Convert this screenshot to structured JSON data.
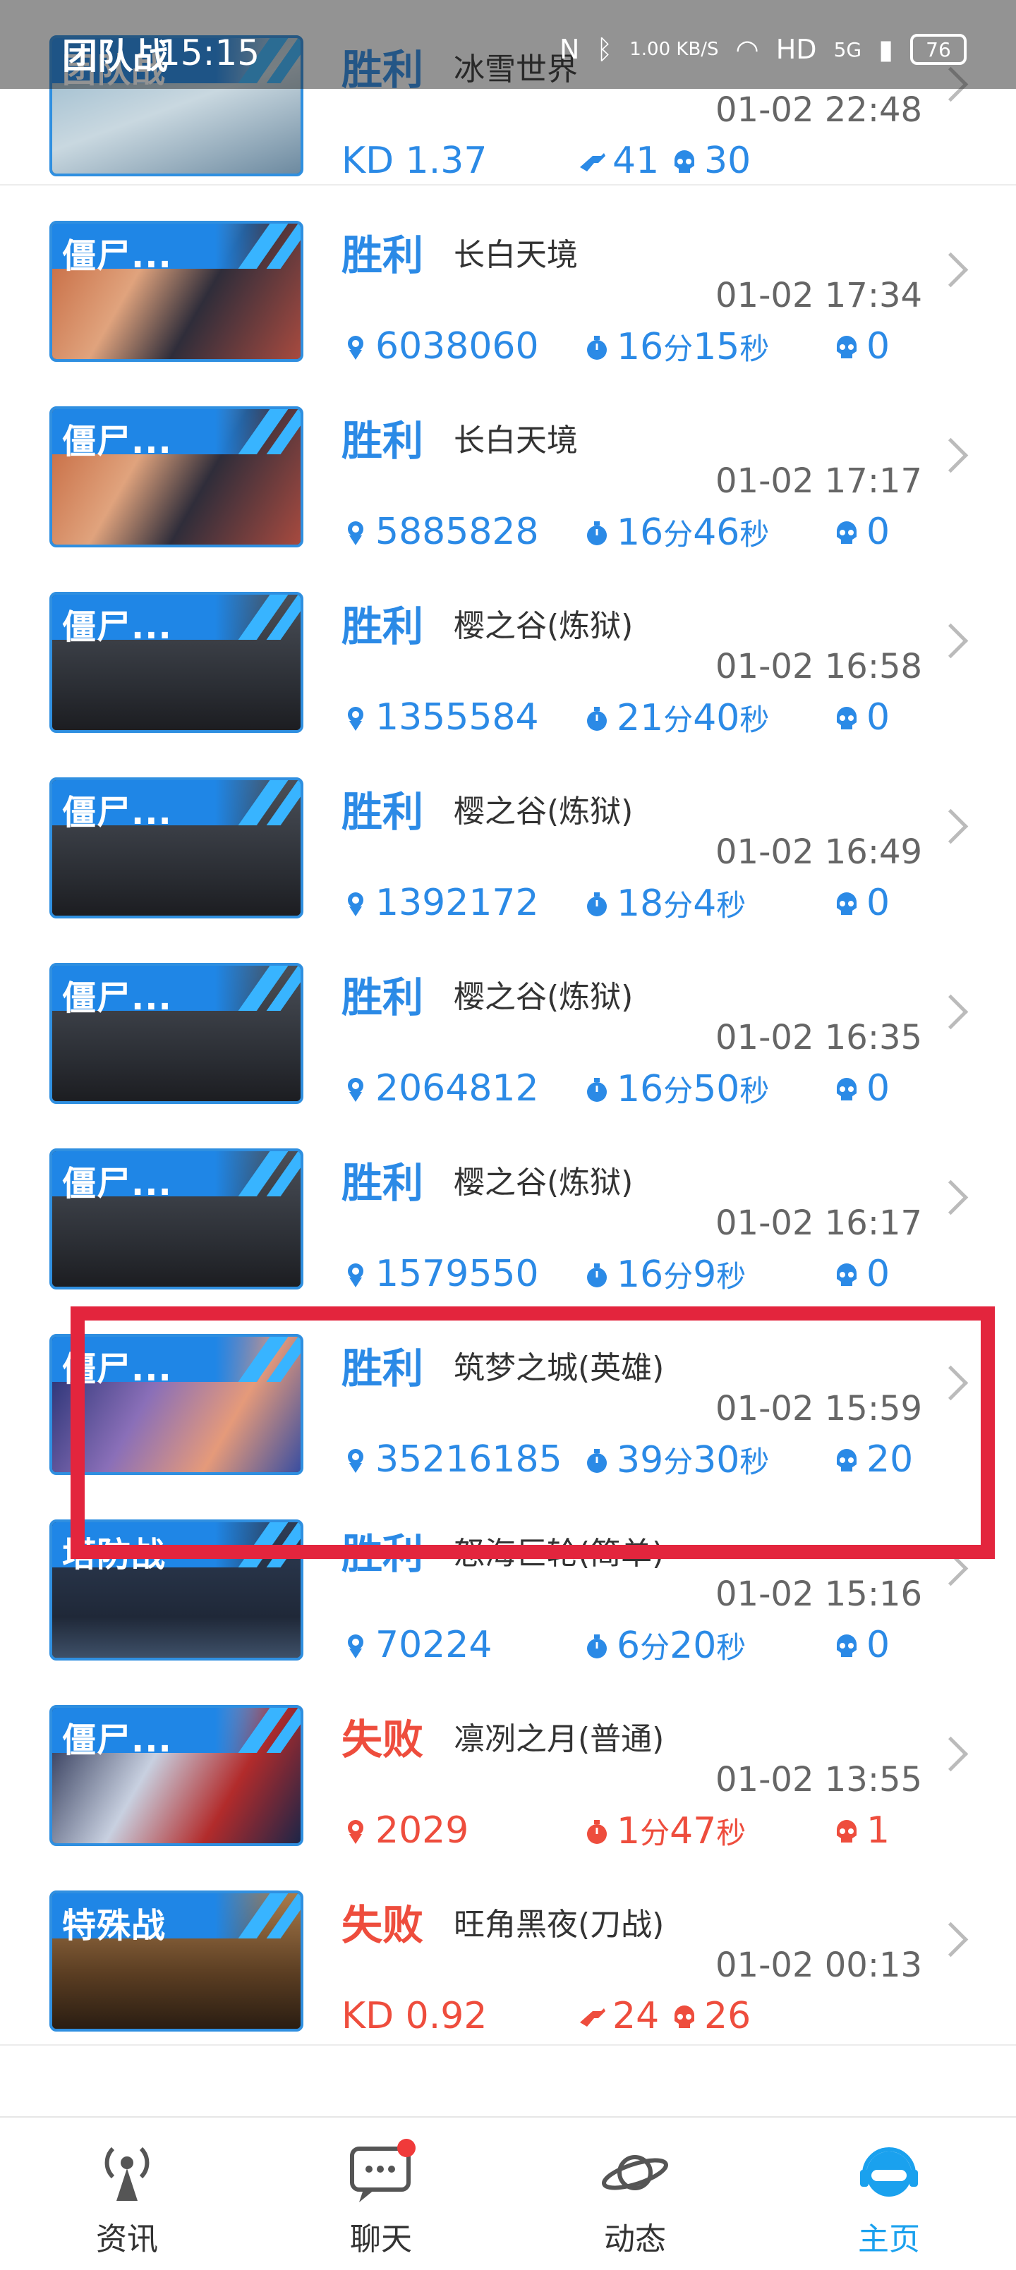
{
  "status_bar": {
    "overlay_badge": "团队战",
    "time": "15:15",
    "net_speed": "1.00 KB/S",
    "network": "5G",
    "battery": "76"
  },
  "records": [
    {
      "mode": "团队战",
      "result": "胜利",
      "map": "冰雪世界",
      "time": "01-02 22:48",
      "stats": {
        "kd": "KD 1.37",
        "kills": "41",
        "deaths": "30"
      }
    },
    {
      "mode": "僵尸...",
      "result": "胜利",
      "map": "长白天境",
      "time": "01-02 17:34",
      "stats": {
        "score": "6038060",
        "duration": {
          "min": "16",
          "sec": "15"
        },
        "deaths": "0"
      }
    },
    {
      "mode": "僵尸...",
      "result": "胜利",
      "map": "长白天境",
      "time": "01-02 17:17",
      "stats": {
        "score": "5885828",
        "duration": {
          "min": "16",
          "sec": "46"
        },
        "deaths": "0"
      }
    },
    {
      "mode": "僵尸...",
      "result": "胜利",
      "map": "樱之谷(炼狱)",
      "time": "01-02 16:58",
      "stats": {
        "score": "1355584",
        "duration": {
          "min": "21",
          "sec": "40"
        },
        "deaths": "0"
      }
    },
    {
      "mode": "僵尸...",
      "result": "胜利",
      "map": "樱之谷(炼狱)",
      "time": "01-02 16:49",
      "stats": {
        "score": "1392172",
        "duration": {
          "min": "18",
          "sec": "4"
        },
        "deaths": "0"
      }
    },
    {
      "mode": "僵尸...",
      "result": "胜利",
      "map": "樱之谷(炼狱)",
      "time": "01-02 16:35",
      "stats": {
        "score": "2064812",
        "duration": {
          "min": "16",
          "sec": "50"
        },
        "deaths": "0"
      }
    },
    {
      "mode": "僵尸...",
      "result": "胜利",
      "map": "樱之谷(炼狱)",
      "time": "01-02 16:17",
      "stats": {
        "score": "1579550",
        "duration": {
          "min": "16",
          "sec": "9"
        },
        "deaths": "0"
      }
    },
    {
      "mode": "僵尸...",
      "result": "胜利",
      "map": "筑梦之城(英雄)",
      "time": "01-02 15:59",
      "stats": {
        "score": "35216185",
        "duration": {
          "min": "39",
          "sec": "30"
        },
        "deaths": "20"
      }
    },
    {
      "mode": "塔防战",
      "result": "胜利",
      "map": "怒海巨轮(简单)",
      "time": "01-02 15:16",
      "stats": {
        "score": "70224",
        "duration": {
          "min": "6",
          "sec": "20"
        },
        "deaths": "0"
      }
    },
    {
      "mode": "僵尸...",
      "result": "失败",
      "map": "凛冽之月(普通)",
      "time": "01-02 13:55",
      "stats": {
        "score": "2029",
        "duration": {
          "min": "1",
          "sec": "47"
        },
        "deaths": "1"
      }
    },
    {
      "mode": "特殊战",
      "result": "失败",
      "map": "旺角黑夜(刀战)",
      "time": "01-02 00:13",
      "stats": {
        "kd": "KD 0.92",
        "kills": "24",
        "deaths": "26"
      }
    }
  ],
  "units": {
    "min": "分",
    "sec": "秒"
  },
  "tabbar": [
    {
      "label": "资讯",
      "icon": "broadcast-icon"
    },
    {
      "label": "聊天",
      "icon": "chat-icon",
      "badge": true
    },
    {
      "label": "动态",
      "icon": "planet-icon"
    },
    {
      "label": "主页",
      "icon": "headset-face-icon",
      "active": true
    }
  ],
  "colors": {
    "win": "#2b8ae6",
    "lose": "#ee4d3d",
    "accent": "#1aa1ee",
    "highlight": "#e3253d"
  }
}
